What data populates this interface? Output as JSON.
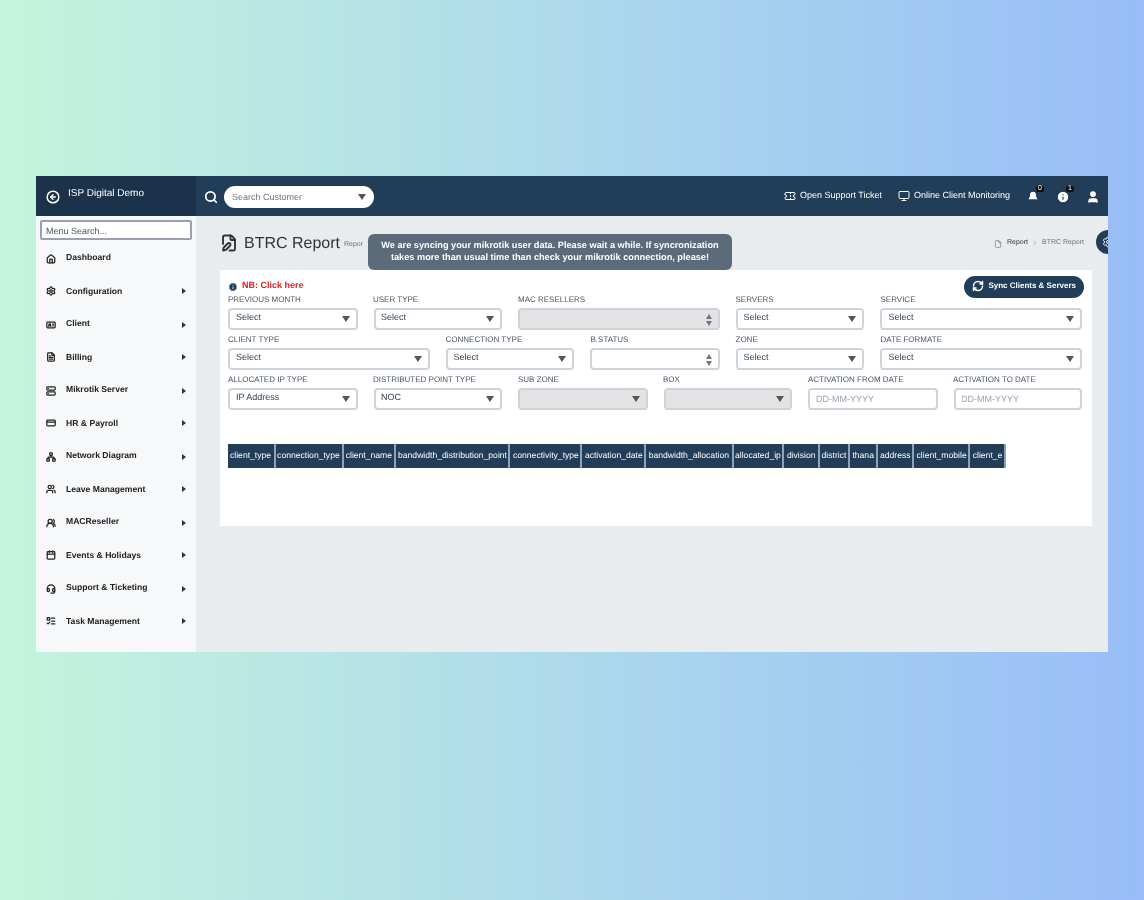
{
  "app": {
    "brand": "ISP Digital Demo"
  },
  "search": {
    "placeholder": "Search Customer"
  },
  "topbar": {
    "links": [
      {
        "label": "Open Support Ticket",
        "kind": "ticket"
      },
      {
        "label": "Online Client Monitoring",
        "kind": "monitor"
      }
    ],
    "badges": [
      {
        "kind": "bell",
        "count": "0"
      },
      {
        "kind": "info",
        "count": "1"
      }
    ]
  },
  "sidebar": {
    "search_placeholder": "Menu Search...",
    "items": [
      {
        "label": "Dashboard",
        "kind": "home",
        "has_submenu": false
      },
      {
        "label": "Configuration",
        "kind": "gear",
        "has_submenu": true
      },
      {
        "label": "Client",
        "kind": "client",
        "has_submenu": true
      },
      {
        "label": "Billing",
        "kind": "billing",
        "has_submenu": true
      },
      {
        "label": "Mikrotik Server",
        "kind": "server",
        "has_submenu": true
      },
      {
        "label": "HR & Payroll",
        "kind": "hr",
        "has_submenu": true
      },
      {
        "label": "Network Diagram",
        "kind": "network",
        "has_submenu": true
      },
      {
        "label": "Leave Management",
        "kind": "leave",
        "has_submenu": true
      },
      {
        "label": "MACReseller",
        "kind": "mac",
        "has_submenu": true
      },
      {
        "label": "Events & Holidays",
        "kind": "events",
        "has_submenu": true
      },
      {
        "label": "Support & Ticketing",
        "kind": "support",
        "has_submenu": true
      },
      {
        "label": "Task Management",
        "kind": "task",
        "has_submenu": true
      }
    ]
  },
  "page": {
    "title": "BTRC Report",
    "subtitle": "Repor",
    "breadcrumb": [
      "Report",
      "BTRC Report"
    ]
  },
  "notice": "We are syncing your mikrotik user data. Please wait a while. If syncronization takes more than usual time than check your mikrotik connection, please!",
  "note_link": "NB: Click here",
  "sync_button": "Sync Clients & Servers",
  "filters": [
    {
      "label": "PREVIOUS MONTH",
      "kind": "select",
      "value": "Select",
      "disabled": false
    },
    {
      "label": "USER TYPE",
      "kind": "select",
      "value": "Select",
      "disabled": false
    },
    {
      "label": "MAC RESELLERS",
      "kind": "multiselect",
      "disabled": true
    },
    {
      "label": "SERVERS",
      "kind": "select",
      "value": "Select",
      "disabled": false
    },
    {
      "label": "SERVICE",
      "kind": "select",
      "value": "Select",
      "disabled": false
    },
    {
      "label": "CLIENT TYPE",
      "kind": "select",
      "value": "Select",
      "disabled": false
    },
    {
      "label": "CONNECTION TYPE",
      "kind": "select",
      "value": "Select",
      "disabled": false
    },
    {
      "label": "B.STATUS",
      "kind": "multiselect",
      "disabled": false
    },
    {
      "label": "ZONE",
      "kind": "select",
      "value": "Select",
      "disabled": false
    },
    {
      "label": "DATE FORMATE",
      "kind": "select",
      "value": "Select",
      "disabled": false
    },
    {
      "label": "ALLOCATED IP TYPE",
      "kind": "select",
      "value": "IP Address",
      "disabled": false
    },
    {
      "label": "DISTRIBUTED POINT TYPE",
      "kind": "select",
      "value": "NOC",
      "disabled": false
    },
    {
      "label": "SUB ZONE",
      "kind": "select",
      "disabled": true
    },
    {
      "label": "BOX",
      "kind": "select",
      "disabled": true
    },
    {
      "label": "ACTIVATION FROM DATE",
      "kind": "date",
      "placeholder": "DD-MM-YYYY",
      "disabled": false
    },
    {
      "label": "ACTIVATION TO DATE",
      "kind": "date",
      "placeholder": "DD-MM-YYYY",
      "disabled": false
    }
  ],
  "table": {
    "columns": [
      "client_type",
      "connection_type",
      "client_name",
      "bandwidth_distribution_point",
      "connectivity_type",
      "activation_date",
      "bandwidth_allocation",
      "allocated_ip",
      "division",
      "district",
      "thana",
      "address",
      "client_mobile",
      "client_e"
    ]
  }
}
